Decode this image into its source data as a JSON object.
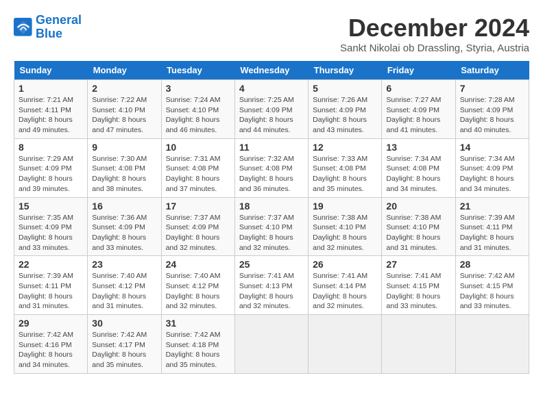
{
  "header": {
    "logo_line1": "General",
    "logo_line2": "Blue",
    "month": "December 2024",
    "location": "Sankt Nikolai ob Drassling, Styria, Austria"
  },
  "weekdays": [
    "Sunday",
    "Monday",
    "Tuesday",
    "Wednesday",
    "Thursday",
    "Friday",
    "Saturday"
  ],
  "days": [
    {
      "num": "",
      "info": ""
    },
    {
      "num": "",
      "info": ""
    },
    {
      "num": "",
      "info": ""
    },
    {
      "num": "",
      "info": ""
    },
    {
      "num": "",
      "info": ""
    },
    {
      "num": "",
      "info": ""
    },
    {
      "num": "",
      "info": ""
    },
    {
      "num": "1",
      "info": "Sunrise: 7:21 AM\nSunset: 4:11 PM\nDaylight: 8 hours and 49 minutes."
    },
    {
      "num": "2",
      "info": "Sunrise: 7:22 AM\nSunset: 4:10 PM\nDaylight: 8 hours and 47 minutes."
    },
    {
      "num": "3",
      "info": "Sunrise: 7:24 AM\nSunset: 4:10 PM\nDaylight: 8 hours and 46 minutes."
    },
    {
      "num": "4",
      "info": "Sunrise: 7:25 AM\nSunset: 4:09 PM\nDaylight: 8 hours and 44 minutes."
    },
    {
      "num": "5",
      "info": "Sunrise: 7:26 AM\nSunset: 4:09 PM\nDaylight: 8 hours and 43 minutes."
    },
    {
      "num": "6",
      "info": "Sunrise: 7:27 AM\nSunset: 4:09 PM\nDaylight: 8 hours and 41 minutes."
    },
    {
      "num": "7",
      "info": "Sunrise: 7:28 AM\nSunset: 4:09 PM\nDaylight: 8 hours and 40 minutes."
    },
    {
      "num": "8",
      "info": "Sunrise: 7:29 AM\nSunset: 4:09 PM\nDaylight: 8 hours and 39 minutes."
    },
    {
      "num": "9",
      "info": "Sunrise: 7:30 AM\nSunset: 4:08 PM\nDaylight: 8 hours and 38 minutes."
    },
    {
      "num": "10",
      "info": "Sunrise: 7:31 AM\nSunset: 4:08 PM\nDaylight: 8 hours and 37 minutes."
    },
    {
      "num": "11",
      "info": "Sunrise: 7:32 AM\nSunset: 4:08 PM\nDaylight: 8 hours and 36 minutes."
    },
    {
      "num": "12",
      "info": "Sunrise: 7:33 AM\nSunset: 4:08 PM\nDaylight: 8 hours and 35 minutes."
    },
    {
      "num": "13",
      "info": "Sunrise: 7:34 AM\nSunset: 4:08 PM\nDaylight: 8 hours and 34 minutes."
    },
    {
      "num": "14",
      "info": "Sunrise: 7:34 AM\nSunset: 4:09 PM\nDaylight: 8 hours and 34 minutes."
    },
    {
      "num": "15",
      "info": "Sunrise: 7:35 AM\nSunset: 4:09 PM\nDaylight: 8 hours and 33 minutes."
    },
    {
      "num": "16",
      "info": "Sunrise: 7:36 AM\nSunset: 4:09 PM\nDaylight: 8 hours and 33 minutes."
    },
    {
      "num": "17",
      "info": "Sunrise: 7:37 AM\nSunset: 4:09 PM\nDaylight: 8 hours and 32 minutes."
    },
    {
      "num": "18",
      "info": "Sunrise: 7:37 AM\nSunset: 4:10 PM\nDaylight: 8 hours and 32 minutes."
    },
    {
      "num": "19",
      "info": "Sunrise: 7:38 AM\nSunset: 4:10 PM\nDaylight: 8 hours and 32 minutes."
    },
    {
      "num": "20",
      "info": "Sunrise: 7:38 AM\nSunset: 4:10 PM\nDaylight: 8 hours and 31 minutes."
    },
    {
      "num": "21",
      "info": "Sunrise: 7:39 AM\nSunset: 4:11 PM\nDaylight: 8 hours and 31 minutes."
    },
    {
      "num": "22",
      "info": "Sunrise: 7:39 AM\nSunset: 4:11 PM\nDaylight: 8 hours and 31 minutes."
    },
    {
      "num": "23",
      "info": "Sunrise: 7:40 AM\nSunset: 4:12 PM\nDaylight: 8 hours and 31 minutes."
    },
    {
      "num": "24",
      "info": "Sunrise: 7:40 AM\nSunset: 4:12 PM\nDaylight: 8 hours and 32 minutes."
    },
    {
      "num": "25",
      "info": "Sunrise: 7:41 AM\nSunset: 4:13 PM\nDaylight: 8 hours and 32 minutes."
    },
    {
      "num": "26",
      "info": "Sunrise: 7:41 AM\nSunset: 4:14 PM\nDaylight: 8 hours and 32 minutes."
    },
    {
      "num": "27",
      "info": "Sunrise: 7:41 AM\nSunset: 4:15 PM\nDaylight: 8 hours and 33 minutes."
    },
    {
      "num": "28",
      "info": "Sunrise: 7:42 AM\nSunset: 4:15 PM\nDaylight: 8 hours and 33 minutes."
    },
    {
      "num": "29",
      "info": "Sunrise: 7:42 AM\nSunset: 4:16 PM\nDaylight: 8 hours and 34 minutes."
    },
    {
      "num": "30",
      "info": "Sunrise: 7:42 AM\nSunset: 4:17 PM\nDaylight: 8 hours and 35 minutes."
    },
    {
      "num": "31",
      "info": "Sunrise: 7:42 AM\nSunset: 4:18 PM\nDaylight: 8 hours and 35 minutes."
    },
    {
      "num": "",
      "info": ""
    },
    {
      "num": "",
      "info": ""
    },
    {
      "num": "",
      "info": ""
    },
    {
      "num": "",
      "info": ""
    }
  ]
}
